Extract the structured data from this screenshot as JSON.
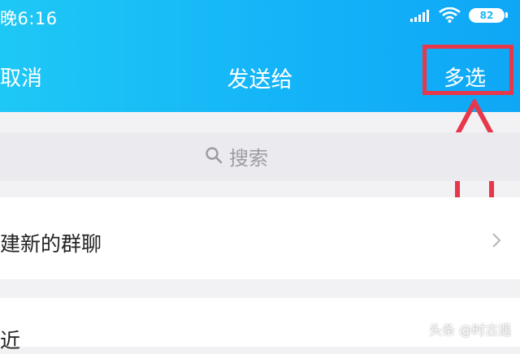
{
  "status_bar": {
    "time": "晚6:16",
    "battery": "82",
    "signal_icon": "signal-icon",
    "wifi_icon": "wifi-icon"
  },
  "nav": {
    "cancel_label": "取消",
    "title": "发送给",
    "multi_select_label": "多选"
  },
  "search": {
    "label": "搜索",
    "icon": "search-icon"
  },
  "list": {
    "create_group_label": "建新的群聊",
    "chevron_icon": "chevron-right-icon",
    "section_label": "近"
  },
  "watermark": "头条 @时古遇",
  "colors": {
    "header_start": "#1ec8f5",
    "header_end": "#0ea7f6",
    "annotation_red": "#e6384a",
    "search_bg": "#ebebef",
    "page_bg": "#f2f2f4"
  }
}
